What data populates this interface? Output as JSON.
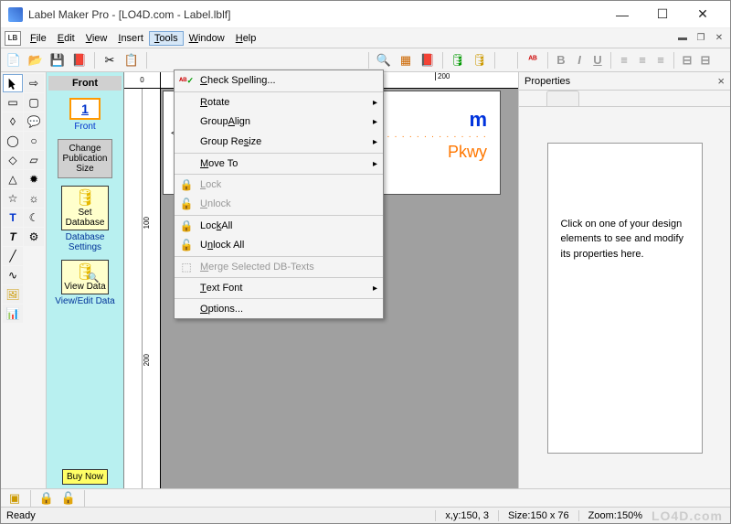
{
  "title": "Label Maker Pro - [LO4D.com - Label.lblf]",
  "menubar": {
    "badge": "LB",
    "items": [
      "File",
      "Edit",
      "View",
      "Insert",
      "Tools",
      "Window",
      "Help"
    ],
    "active": "Tools"
  },
  "dropdown": {
    "items": [
      {
        "label": "Check Spelling...",
        "u": "C",
        "icon": "✔",
        "iconcolor": "#009900"
      },
      {
        "label": "Rotate",
        "u": "R",
        "sub": true,
        "sep": true
      },
      {
        "label": "Group Align",
        "u": "A",
        "sub": true
      },
      {
        "label": "Group Resize",
        "u": "s",
        "sub": true
      },
      {
        "label": "Move To",
        "u": "M",
        "sub": true,
        "sep": true
      },
      {
        "label": "Lock",
        "u": "L",
        "icon": "🔒",
        "disabled": true,
        "sep": true
      },
      {
        "label": "Unlock",
        "u": "U",
        "icon": "🔓",
        "disabled": true
      },
      {
        "label": "Lock All",
        "u": "k",
        "icon": "🔒",
        "sep": true
      },
      {
        "label": "Unlock All",
        "u": "n",
        "icon": "🔓"
      },
      {
        "label": "Merge Selected DB-Texts",
        "u": "M",
        "icon": "⬚",
        "disabled": true,
        "sep": true
      },
      {
        "label": "Text Font",
        "u": "T",
        "sub": true,
        "sep": true
      },
      {
        "label": "Options...",
        "u": "O",
        "sep": true
      }
    ]
  },
  "side": {
    "head": "Front",
    "front_num": "1",
    "front_caption": "Front",
    "change": "Change Publication Size",
    "set_db": "Set Database",
    "db_settings": "Database Settings",
    "view_data": "View Data",
    "view_edit": "View/Edit Data",
    "buy_now": "Buy Now"
  },
  "canvas": {
    "ruler0": "0",
    "ruler200": "200",
    "ruler100v": "100",
    "ruler200v": "200",
    "txt1": "m",
    "txt2": "Pkwy"
  },
  "props": {
    "title": "Properties",
    "body": "Click on one of your design elements to see and modify its properties here."
  },
  "status": {
    "ready": "Ready",
    "xy": "x,y:150, 3",
    "size": "Size:150 x 76",
    "zoom": "Zoom:150%"
  },
  "fmt": {
    "b": "B",
    "i": "I",
    "u": "U"
  },
  "watermark": "LO4D.com"
}
